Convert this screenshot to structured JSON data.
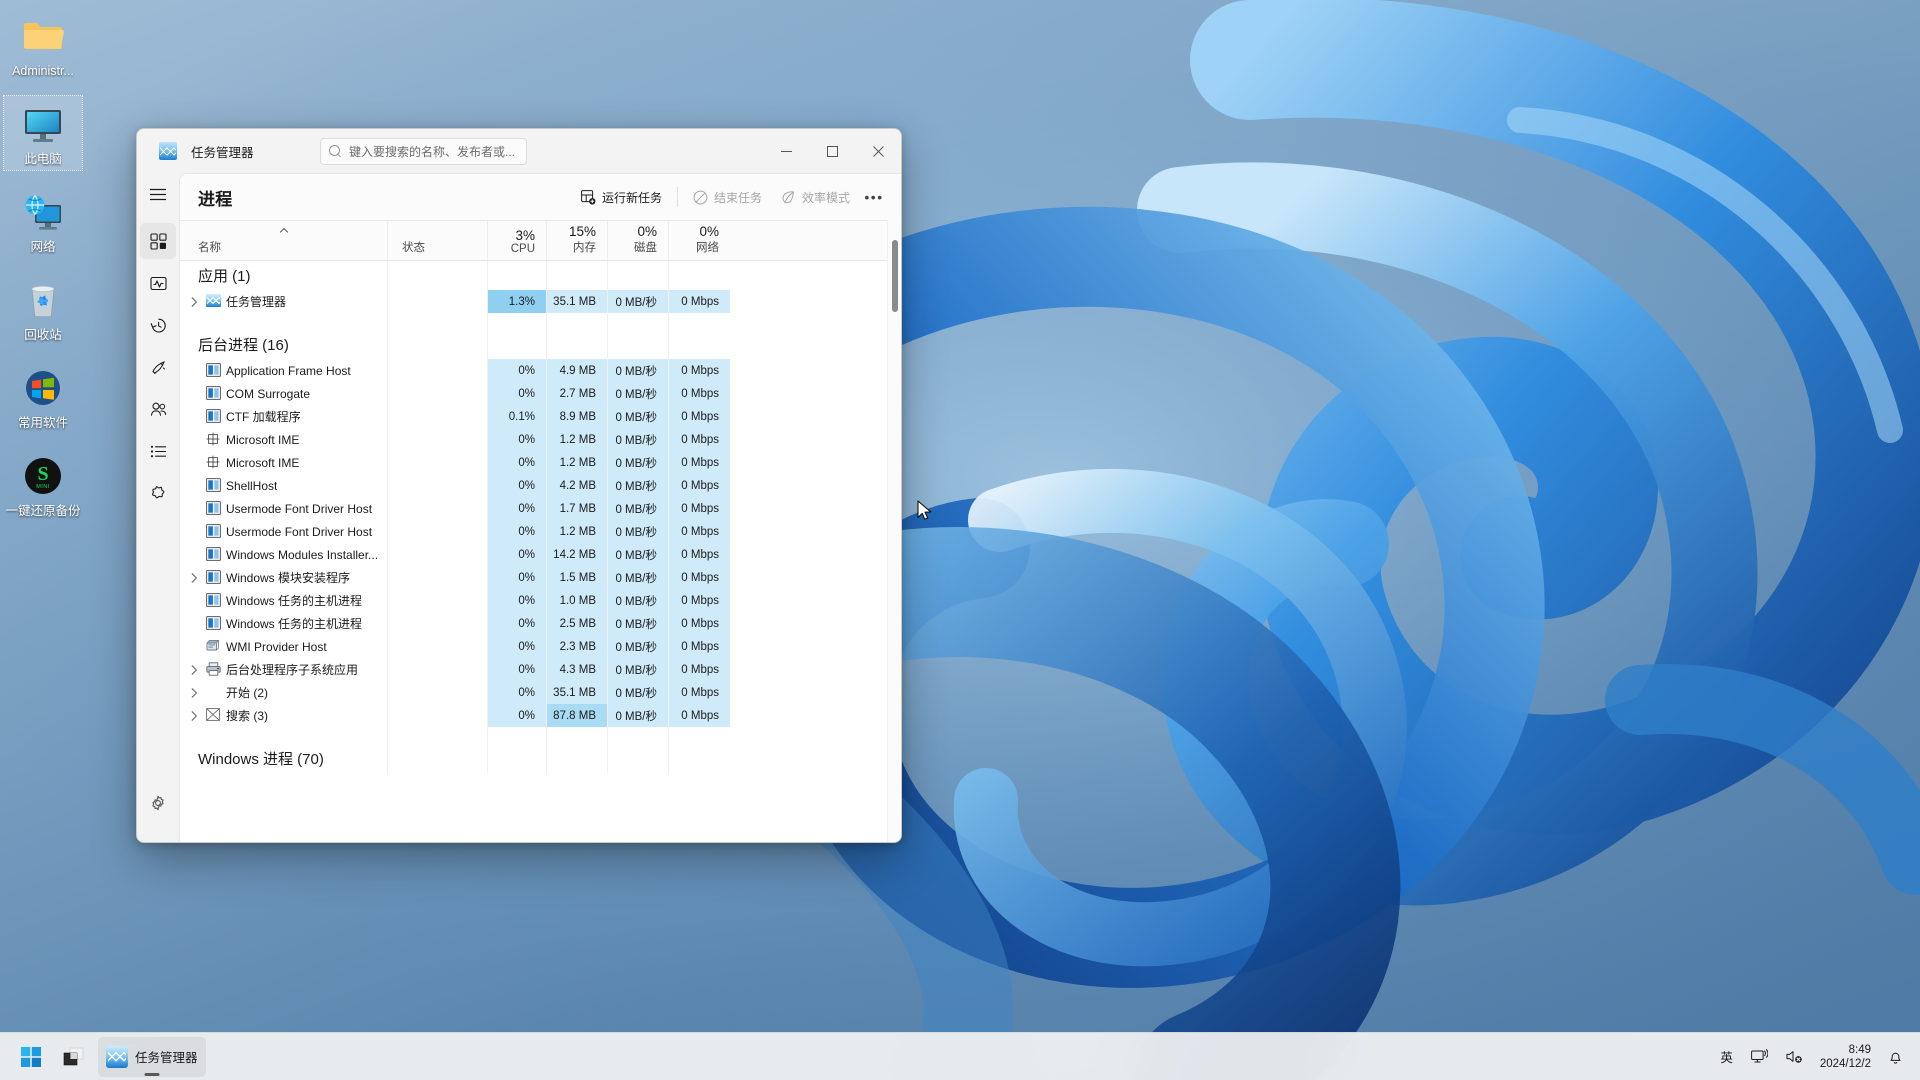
{
  "desktop": {
    "icons": [
      {
        "label": "Administr...",
        "icon": "folder-icon",
        "selected": false
      },
      {
        "label": "此电脑",
        "icon": "this-pc-icon",
        "selected": true
      },
      {
        "label": "网络",
        "icon": "network-icon",
        "selected": false
      },
      {
        "label": "回收站",
        "icon": "recycle-bin-icon",
        "selected": false
      },
      {
        "label": "常用软件",
        "icon": "common-software-icon",
        "selected": false
      },
      {
        "label": "一键还原备份",
        "icon": "one-key-restore-icon",
        "selected": false
      }
    ]
  },
  "window": {
    "title": "任务管理器",
    "search_placeholder": "键入要搜索的名称、发布者或...",
    "controls": {
      "minimize": "最小化",
      "maximize": "最大化",
      "close": "关闭"
    }
  },
  "sidebar": {
    "items": [
      {
        "name": "menu",
        "icon": "hamburger-icon",
        "tooltip": ""
      },
      {
        "name": "processes",
        "icon": "processes-icon",
        "tooltip": "进程",
        "active": true
      },
      {
        "name": "performance",
        "icon": "performance-icon",
        "tooltip": "性能"
      },
      {
        "name": "app-history",
        "icon": "app-history-icon",
        "tooltip": "应用历史记录"
      },
      {
        "name": "startup-apps",
        "icon": "startup-apps-icon",
        "tooltip": "启动应用"
      },
      {
        "name": "users",
        "icon": "users-icon",
        "tooltip": "用户"
      },
      {
        "name": "details",
        "icon": "details-icon",
        "tooltip": "详细信息"
      },
      {
        "name": "services",
        "icon": "services-icon",
        "tooltip": "服务"
      }
    ],
    "settings": {
      "name": "settings",
      "icon": "gear-icon",
      "tooltip": "设置"
    }
  },
  "toolbar": {
    "page_title": "进程",
    "run_new_task": "运行新任务",
    "end_task": "结束任务",
    "efficiency_mode": "效率模式",
    "more": "•••"
  },
  "table": {
    "headers": {
      "name": "名称",
      "status": "状态",
      "cpu": {
        "pct": "3%",
        "label": "CPU"
      },
      "memory": {
        "pct": "15%",
        "label": "内存"
      },
      "disk": {
        "pct": "0%",
        "label": "磁盘"
      },
      "network": {
        "pct": "0%",
        "label": "网络"
      }
    },
    "rows": [
      {
        "type": "group",
        "name": "应用 (1)"
      },
      {
        "type": "proc",
        "name": "任务管理器",
        "expandable": true,
        "icon": "taskmgr-icon",
        "status": "",
        "cpu": "1.3%",
        "mem": "35.1 MB",
        "disk": "0 MB/秒",
        "net": "0 Mbps",
        "heat": {
          "cpu": 3,
          "mem": 1,
          "disk": 1,
          "net": 1
        }
      },
      {
        "type": "spacer"
      },
      {
        "type": "group",
        "name": "后台进程 (16)"
      },
      {
        "type": "proc",
        "name": "Application Frame Host",
        "expandable": false,
        "icon": "window-icon",
        "status": "",
        "cpu": "0%",
        "mem": "4.9 MB",
        "disk": "0 MB/秒",
        "net": "0 Mbps",
        "heat": {
          "cpu": 1,
          "mem": 1,
          "disk": 1,
          "net": 1
        }
      },
      {
        "type": "proc",
        "name": "COM Surrogate",
        "expandable": false,
        "icon": "window-icon",
        "status": "",
        "cpu": "0%",
        "mem": "2.7 MB",
        "disk": "0 MB/秒",
        "net": "0 Mbps",
        "heat": {
          "cpu": 1,
          "mem": 1,
          "disk": 1,
          "net": 1
        }
      },
      {
        "type": "proc",
        "name": "CTF 加载程序",
        "expandable": false,
        "icon": "window-icon",
        "status": "",
        "cpu": "0.1%",
        "mem": "8.9 MB",
        "disk": "0 MB/秒",
        "net": "0 Mbps",
        "heat": {
          "cpu": 1,
          "mem": 1,
          "disk": 1,
          "net": 1
        }
      },
      {
        "type": "proc",
        "name": "Microsoft IME",
        "expandable": false,
        "icon": "ime-icon",
        "status": "",
        "cpu": "0%",
        "mem": "1.2 MB",
        "disk": "0 MB/秒",
        "net": "0 Mbps",
        "heat": {
          "cpu": 1,
          "mem": 1,
          "disk": 1,
          "net": 1
        }
      },
      {
        "type": "proc",
        "name": "Microsoft IME",
        "expandable": false,
        "icon": "ime-icon",
        "status": "",
        "cpu": "0%",
        "mem": "1.2 MB",
        "disk": "0 MB/秒",
        "net": "0 Mbps",
        "heat": {
          "cpu": 1,
          "mem": 1,
          "disk": 1,
          "net": 1
        }
      },
      {
        "type": "proc",
        "name": "ShellHost",
        "expandable": false,
        "icon": "window-icon",
        "status": "",
        "cpu": "0%",
        "mem": "4.2 MB",
        "disk": "0 MB/秒",
        "net": "0 Mbps",
        "heat": {
          "cpu": 1,
          "mem": 1,
          "disk": 1,
          "net": 1
        }
      },
      {
        "type": "proc",
        "name": "Usermode Font Driver Host",
        "expandable": false,
        "icon": "window-icon",
        "status": "",
        "cpu": "0%",
        "mem": "1.7 MB",
        "disk": "0 MB/秒",
        "net": "0 Mbps",
        "heat": {
          "cpu": 1,
          "mem": 1,
          "disk": 1,
          "net": 1
        }
      },
      {
        "type": "proc",
        "name": "Usermode Font Driver Host",
        "expandable": false,
        "icon": "window-icon",
        "status": "",
        "cpu": "0%",
        "mem": "1.2 MB",
        "disk": "0 MB/秒",
        "net": "0 Mbps",
        "heat": {
          "cpu": 1,
          "mem": 1,
          "disk": 1,
          "net": 1
        }
      },
      {
        "type": "proc",
        "name": "Windows Modules Installer...",
        "expandable": false,
        "icon": "window-icon",
        "status": "",
        "cpu": "0%",
        "mem": "14.2 MB",
        "disk": "0 MB/秒",
        "net": "0 Mbps",
        "heat": {
          "cpu": 1,
          "mem": 1,
          "disk": 1,
          "net": 1
        }
      },
      {
        "type": "proc",
        "name": "Windows 模块安装程序",
        "expandable": true,
        "icon": "window-icon",
        "status": "",
        "cpu": "0%",
        "mem": "1.5 MB",
        "disk": "0 MB/秒",
        "net": "0 Mbps",
        "heat": {
          "cpu": 1,
          "mem": 1,
          "disk": 1,
          "net": 1
        }
      },
      {
        "type": "proc",
        "name": "Windows 任务的主机进程",
        "expandable": false,
        "icon": "window-icon",
        "status": "",
        "cpu": "0%",
        "mem": "1.0 MB",
        "disk": "0 MB/秒",
        "net": "0 Mbps",
        "heat": {
          "cpu": 1,
          "mem": 1,
          "disk": 1,
          "net": 1
        }
      },
      {
        "type": "proc",
        "name": "Windows 任务的主机进程",
        "expandable": false,
        "icon": "window-icon",
        "status": "",
        "cpu": "0%",
        "mem": "2.5 MB",
        "disk": "0 MB/秒",
        "net": "0 Mbps",
        "heat": {
          "cpu": 1,
          "mem": 1,
          "disk": 1,
          "net": 1
        }
      },
      {
        "type": "proc",
        "name": "WMI Provider Host",
        "expandable": false,
        "icon": "wmi-icon",
        "status": "",
        "cpu": "0%",
        "mem": "2.3 MB",
        "disk": "0 MB/秒",
        "net": "0 Mbps",
        "heat": {
          "cpu": 1,
          "mem": 1,
          "disk": 1,
          "net": 1
        }
      },
      {
        "type": "proc",
        "name": "后台处理程序子系统应用",
        "expandable": true,
        "icon": "printer-icon",
        "status": "",
        "cpu": "0%",
        "mem": "4.3 MB",
        "disk": "0 MB/秒",
        "net": "0 Mbps",
        "heat": {
          "cpu": 1,
          "mem": 1,
          "disk": 1,
          "net": 1
        }
      },
      {
        "type": "proc",
        "name": "开始 (2)",
        "expandable": true,
        "icon": "none",
        "status": "",
        "cpu": "0%",
        "mem": "35.1 MB",
        "disk": "0 MB/秒",
        "net": "0 Mbps",
        "heat": {
          "cpu": 1,
          "mem": 1,
          "disk": 1,
          "net": 1
        }
      },
      {
        "type": "proc",
        "name": "搜索 (3)",
        "expandable": true,
        "icon": "search-box-icon",
        "status": "",
        "cpu": "0%",
        "mem": "87.8 MB",
        "disk": "0 MB/秒",
        "net": "0 Mbps",
        "heat": {
          "cpu": 1,
          "mem": 2,
          "disk": 1,
          "net": 1
        }
      },
      {
        "type": "spacer"
      },
      {
        "type": "group",
        "name": "Windows 进程 (70)"
      }
    ]
  },
  "taskbar": {
    "items": [
      {
        "name": "start",
        "icon": "windows-start-icon",
        "label": ""
      },
      {
        "name": "task-view",
        "icon": "task-view-icon",
        "label": ""
      },
      {
        "name": "taskmanager",
        "icon": "taskmgr-icon",
        "label": "任务管理器",
        "active": true
      }
    ],
    "tray": {
      "ime": "英",
      "network_icon": "network-tray-icon",
      "volume_icon": "volume-muted-icon",
      "time": "8:49",
      "date": "2024/12/2",
      "notification_icon": "bell-icon"
    }
  }
}
